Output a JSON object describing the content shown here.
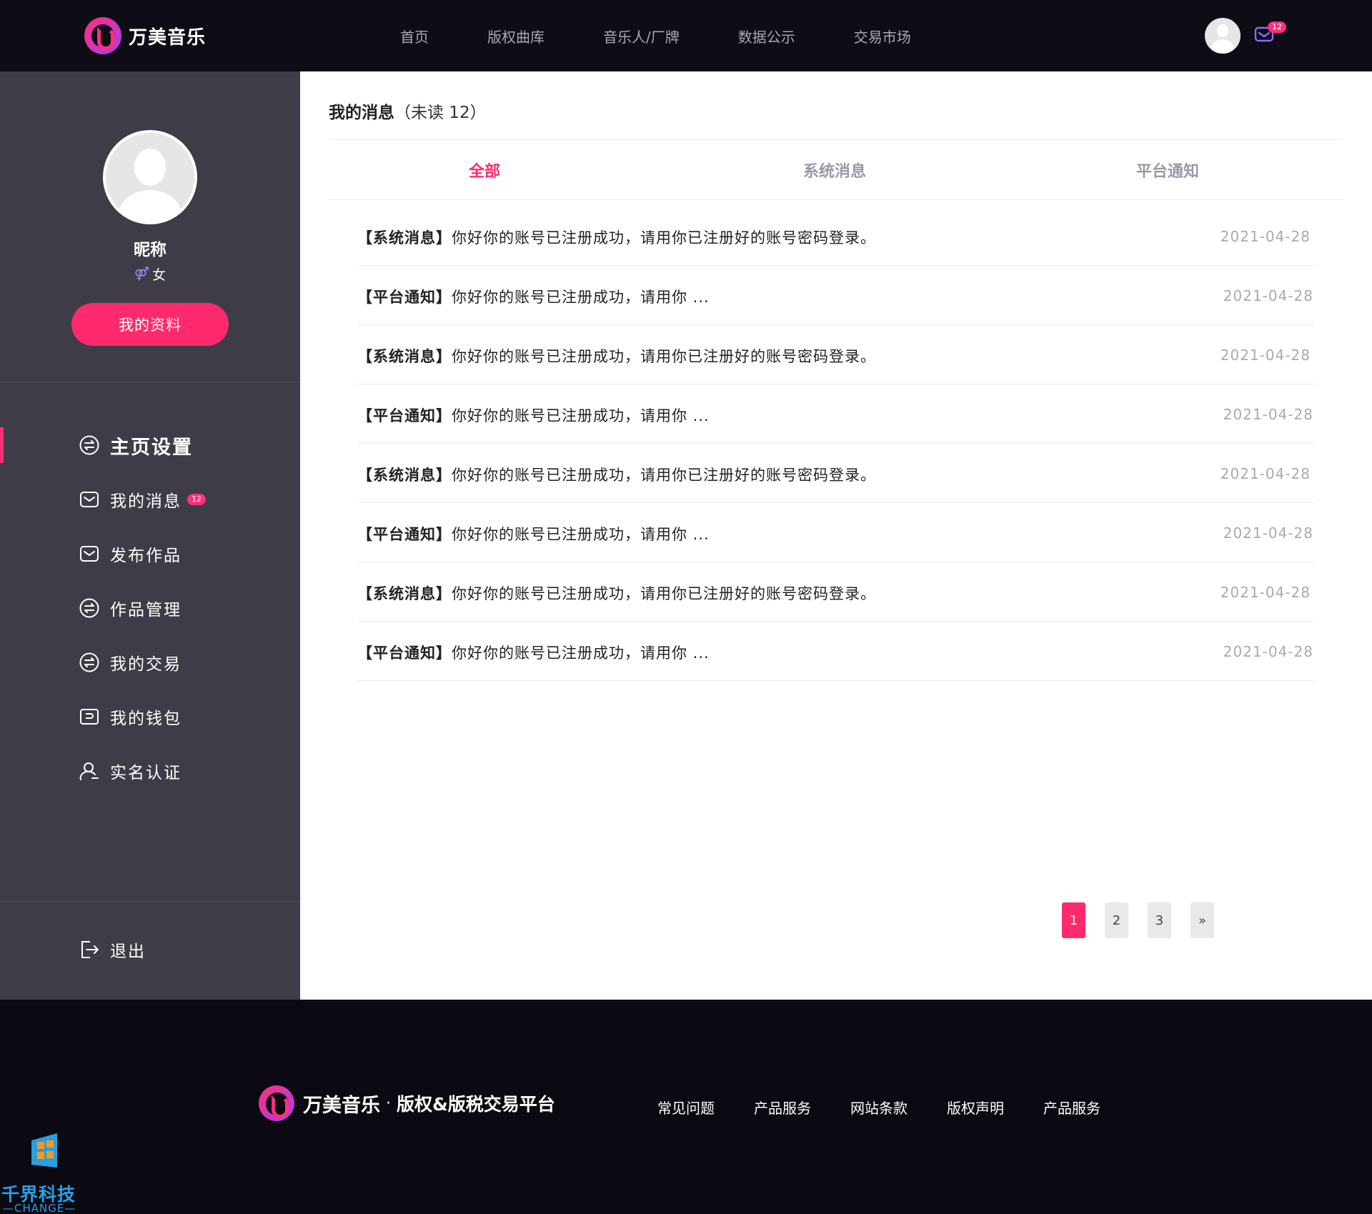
{
  "header": {
    "brand": "万美音乐",
    "nav": [
      "首页",
      "版权曲库",
      "音乐人/厂牌",
      "数据公示",
      "交易市场"
    ],
    "mail_badge": "12"
  },
  "sidebar": {
    "nickname": "昵称",
    "gender": "女",
    "profile_button": "我的资料",
    "items": [
      {
        "label": "主页设置",
        "icon": "exchange-icon",
        "active": true
      },
      {
        "label": "我的消息",
        "icon": "mail-icon",
        "badge": "12"
      },
      {
        "label": "发布作品",
        "icon": "mail-icon"
      },
      {
        "label": "作品管理",
        "icon": "exchange-icon"
      },
      {
        "label": "我的交易",
        "icon": "exchange-icon"
      },
      {
        "label": "我的钱包",
        "icon": "wallet-icon"
      },
      {
        "label": "实名认证",
        "icon": "user-icon"
      }
    ],
    "logout": "退出"
  },
  "main": {
    "title": "我的消息",
    "unread": "（未读 12）",
    "tabs": [
      "全部",
      "系统消息",
      "平台通知"
    ],
    "messages": [
      {
        "tag": "【系统消息】",
        "text": "你好你的账号已注册成功，请用你已注册好的账号密码登录。",
        "date": "2021-04-28"
      },
      {
        "tag": "【平台通知】",
        "text": "你好你的账号已注册成功，请用你 ...",
        "date": "2021-04-28"
      },
      {
        "tag": "【系统消息】",
        "text": "你好你的账号已注册成功，请用你已注册好的账号密码登录。",
        "date": "2021-04-28"
      },
      {
        "tag": "【平台通知】",
        "text": "你好你的账号已注册成功，请用你 ...",
        "date": "2021-04-28"
      },
      {
        "tag": "【系统消息】",
        "text": "你好你的账号已注册成功，请用你已注册好的账号密码登录。",
        "date": "2021-04-28"
      },
      {
        "tag": "【平台通知】",
        "text": "你好你的账号已注册成功，请用你 ...",
        "date": "2021-04-28"
      },
      {
        "tag": "【系统消息】",
        "text": "你好你的账号已注册成功，请用你已注册好的账号密码登录。",
        "date": "2021-04-28"
      },
      {
        "tag": "【平台通知】",
        "text": "你好你的账号已注册成功，请用你 ...",
        "date": "2021-04-28"
      }
    ],
    "pagination": [
      "1",
      "2",
      "3",
      "»"
    ]
  },
  "footer": {
    "brand": "万美音乐",
    "separator": "·",
    "slogan": "版权&版税交易平台",
    "links": [
      "常见问题",
      "产品服务",
      "网站条款",
      "版权声明",
      "产品服务"
    ]
  },
  "watermark": {
    "text": "千界科技",
    "sub": "—CHANGE—"
  },
  "colors": {
    "accent": "#ff2a6d",
    "sidebar": "#3e3d47",
    "header": "#0e0d16"
  }
}
